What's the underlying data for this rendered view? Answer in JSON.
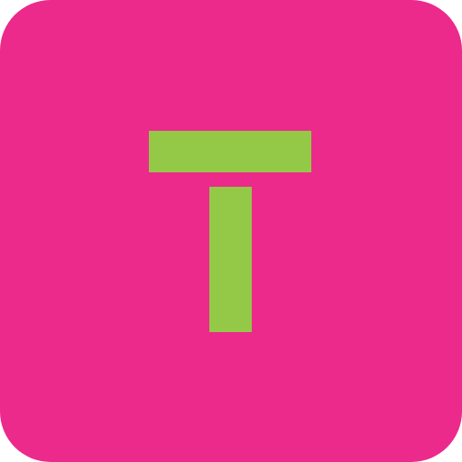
{
  "app_icon": {
    "icon_name": "letter-t-icon",
    "colors": {
      "background": "#EC2A8B",
      "glyph": "#94C947"
    }
  }
}
